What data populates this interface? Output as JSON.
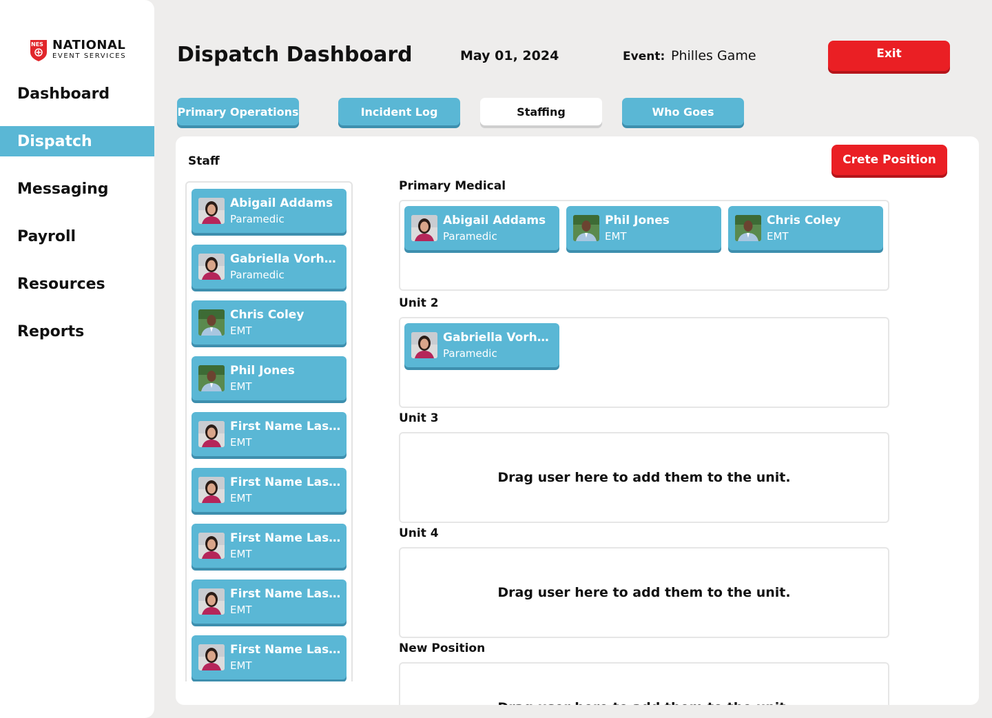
{
  "brand": {
    "badge": "NES",
    "name": "NATIONAL",
    "sub": "EVENT SERVICES"
  },
  "nav": [
    {
      "label": "Dashboard",
      "active": false
    },
    {
      "label": "Dispatch",
      "active": true
    },
    {
      "label": "Messaging",
      "active": false
    },
    {
      "label": "Payroll",
      "active": false
    },
    {
      "label": "Resources",
      "active": false
    },
    {
      "label": "Reports",
      "active": false
    }
  ],
  "header": {
    "title": "Dispatch Dashboard",
    "date": "May 01, 2024",
    "event_label": "Event:",
    "event_value": "Philles Game",
    "exit_label": "Exit"
  },
  "tabs": [
    {
      "label": "Primary Operations",
      "active": false
    },
    {
      "label": "Incident Log",
      "active": false
    },
    {
      "label": "Staffing",
      "active": true
    },
    {
      "label": "Who Goes",
      "active": false
    }
  ],
  "panel": {
    "staff_label": "Staff",
    "create_label": "Crete Position"
  },
  "staff": [
    {
      "name": "Abigail Addams",
      "role": "Paramedic",
      "avatar": "woman-avatar-icon"
    },
    {
      "name": "Gabriella Vorhees",
      "role": "Paramedic",
      "avatar": "woman-avatar-icon"
    },
    {
      "name": "Chris Coley",
      "role": "EMT",
      "avatar": "man-avatar-icon"
    },
    {
      "name": "Phil Jones",
      "role": "EMT",
      "avatar": "man-avatar-icon"
    },
    {
      "name": "First Name Last...",
      "role": "EMT",
      "avatar": "woman-avatar-icon"
    },
    {
      "name": "First Name Last...",
      "role": "EMT",
      "avatar": "woman-avatar-icon"
    },
    {
      "name": "First Name Last...",
      "role": "EMT",
      "avatar": "woman-avatar-icon"
    },
    {
      "name": "First Name Last...",
      "role": "EMT",
      "avatar": "woman-avatar-icon"
    },
    {
      "name": "First Name Last...",
      "role": "EMT",
      "avatar": "woman-avatar-icon"
    }
  ],
  "positions": [
    {
      "label": "Primary Medical",
      "members": [
        {
          "name": "Abigail Addams",
          "role": "Paramedic"
        },
        {
          "name": "Phil Jones",
          "role": "EMT"
        },
        {
          "name": "Chris Coley",
          "role": "EMT"
        }
      ]
    },
    {
      "label": "Unit 2",
      "members": [
        {
          "name": "Gabriella Vorhees",
          "role": "Paramedic"
        }
      ]
    },
    {
      "label": "Unit 3",
      "hint": "Drag user here to add them to the unit."
    },
    {
      "label": "Unit 4",
      "hint": "Drag user here to add them to the unit."
    },
    {
      "label": "New Position",
      "hint": "Drag user here to add them to the unit."
    }
  ],
  "colors": {
    "accent": "#5ab7d5",
    "danger": "#ea1f24"
  }
}
